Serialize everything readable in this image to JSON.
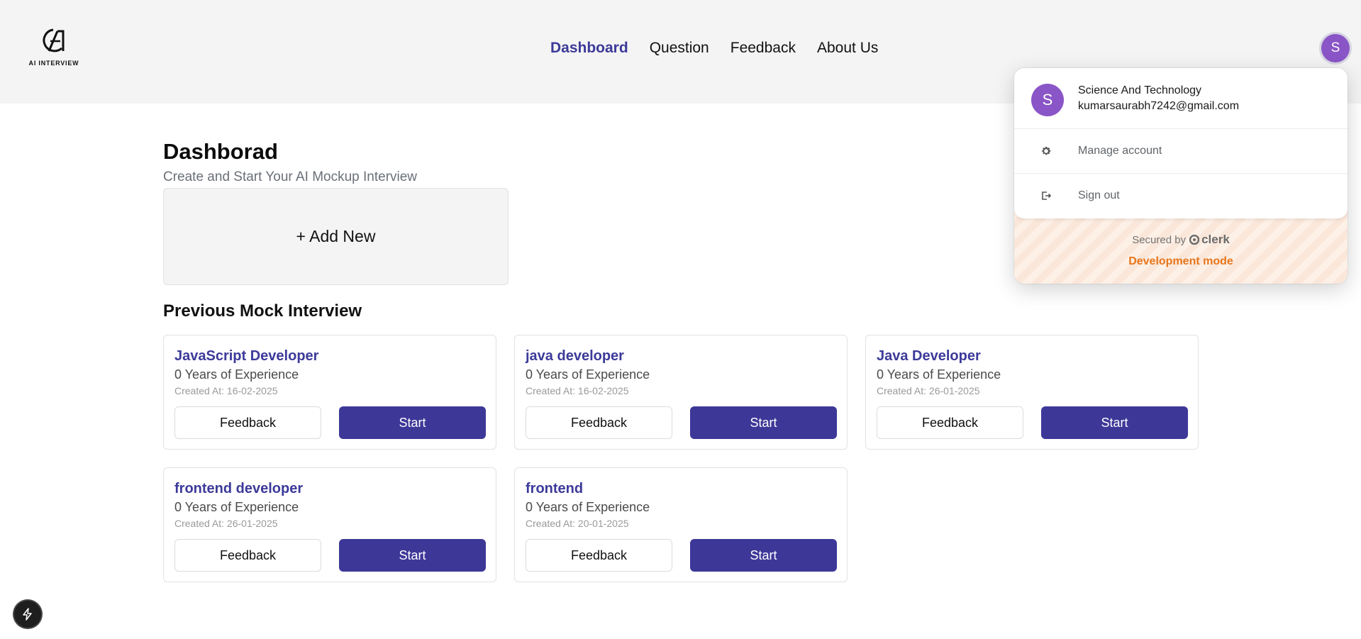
{
  "brand": {
    "logo_text": "AI INTERVIEW",
    "icon": "ai-interview-logo-icon"
  },
  "nav": [
    {
      "label": "Dashboard",
      "active": true
    },
    {
      "label": "Question",
      "active": false
    },
    {
      "label": "Feedback",
      "active": false
    },
    {
      "label": "About Us",
      "active": false
    }
  ],
  "user": {
    "initial": "S",
    "name": "Science And Technology",
    "email": "kumarsaurabh7242@gmail.com"
  },
  "page": {
    "title": "Dashborad",
    "subtitle": "Create and Start Your AI Mockup Interview",
    "add_new_label": "+ Add New",
    "section_title": "Previous Mock Interview"
  },
  "interviews": [
    {
      "role": "JavaScript Developer",
      "experience": "0 Years of Experience",
      "created": "Created At: 16-02-2025",
      "feedback_label": "Feedback",
      "start_label": "Start"
    },
    {
      "role": "java developer",
      "experience": "0 Years of Experience",
      "created": "Created At: 16-02-2025",
      "feedback_label": "Feedback",
      "start_label": "Start"
    },
    {
      "role": "Java Developer",
      "experience": "0 Years of Experience",
      "created": "Created At: 26-01-2025",
      "feedback_label": "Feedback",
      "start_label": "Start"
    },
    {
      "role": "frontend developer",
      "experience": "0 Years of Experience",
      "created": "Created At: 26-01-2025",
      "feedback_label": "Feedback",
      "start_label": "Start"
    },
    {
      "role": "frontend",
      "experience": "0 Years of Experience",
      "created": "Created At: 20-01-2025",
      "feedback_label": "Feedback",
      "start_label": "Start"
    }
  ],
  "popover": {
    "manage_account": "Manage account",
    "sign_out": "Sign out",
    "secured_by": "Secured by",
    "clerk": "clerk",
    "dev_mode": "Development mode"
  },
  "colors": {
    "accent": "#3c3a99",
    "button": "#3d3898",
    "avatar": "#8a55c7",
    "dev_mode": "#e8751a"
  }
}
